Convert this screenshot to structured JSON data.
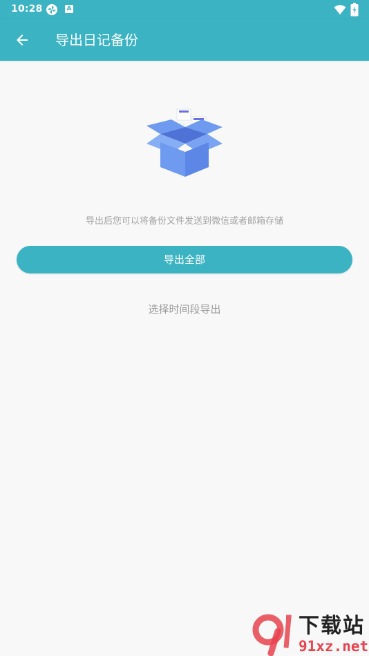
{
  "status_bar": {
    "time": "10:28",
    "icons": [
      "sync-icon",
      "a-icon",
      "wifi-icon",
      "battery-charging-icon"
    ],
    "notification_letter": "A"
  },
  "app_bar": {
    "back_icon": "arrow-left-icon",
    "title": "导出日记备份"
  },
  "main": {
    "illustration": "open-box-icon",
    "hint": "导出后您可以将备份文件发送到微信或者邮箱存储",
    "export_all_label": "导出全部",
    "select_range_label": "选择时间段导出"
  },
  "watermark": {
    "logo_text": "9",
    "title": "下载站",
    "domain": "91xz.net"
  },
  "colors": {
    "primary": "#3bb3c3",
    "background": "#f8f8f8",
    "hint_text": "#a3a3a3",
    "link_text": "#9a9a9a",
    "box_blue": "#6e9bf0",
    "watermark_red": "#e8434f"
  }
}
